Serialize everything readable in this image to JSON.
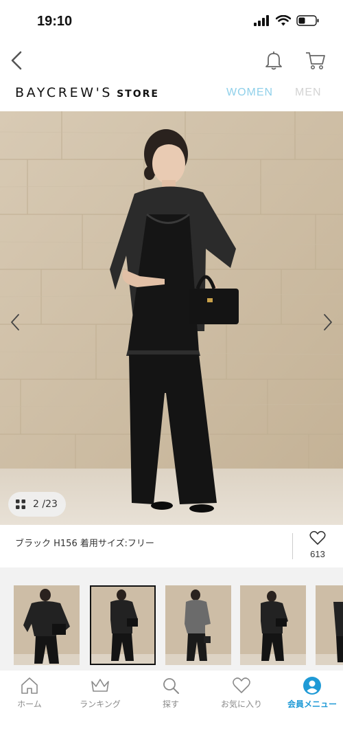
{
  "status_bar": {
    "time": "19:10",
    "icons": [
      "signal-icon",
      "wifi-icon",
      "battery-icon"
    ]
  },
  "header": {
    "back_icon": "chevron-left-icon",
    "notification_icon": "bell-icon",
    "cart_icon": "cart-icon"
  },
  "brand": {
    "name": "BAYCREW'S",
    "suffix": "STORE"
  },
  "gender_tabs": [
    {
      "label": "WOMEN",
      "active": true,
      "color": "#8fd0ea"
    },
    {
      "label": "MEN",
      "active": false,
      "color": "#d3d3d3"
    }
  ],
  "gallery": {
    "current": "2",
    "total": "/23",
    "grid_icon": "grid-icon",
    "prev_icon": "chevron-left-icon",
    "next_icon": "chevron-right-icon"
  },
  "product_caption": "ブラック H156 着用サイズ:フリー",
  "favorite": {
    "icon": "heart-icon",
    "count": "613"
  },
  "thumbnails": {
    "count_visible": 5,
    "selected_index": 1
  },
  "bottom_nav": [
    {
      "label": "ホーム",
      "icon": "home-icon",
      "active": false
    },
    {
      "label": "ランキング",
      "icon": "crown-icon",
      "active": false
    },
    {
      "label": "探す",
      "icon": "search-icon",
      "active": false
    },
    {
      "label": "お気に入り",
      "icon": "heart-icon",
      "active": false
    },
    {
      "label": "会員メニュー",
      "icon": "user-circle-icon",
      "active": true
    }
  ],
  "colors": {
    "accent": "#1f9ad6",
    "women_tab": "#8fd0ea",
    "men_tab": "#d3d3d3"
  }
}
